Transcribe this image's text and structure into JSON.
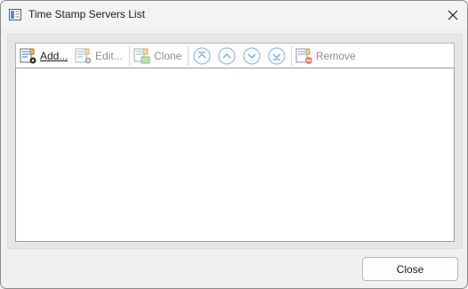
{
  "window": {
    "title": "Time Stamp Servers List"
  },
  "toolbar": {
    "add_label": "Add...",
    "edit_label": "Edit...",
    "clone_label": "Clone",
    "remove_label": "Remove",
    "nav_icons": [
      "move-to-top-icon",
      "move-up-icon",
      "move-down-icon",
      "move-to-bottom-icon"
    ]
  },
  "list": {
    "items": []
  },
  "footer": {
    "close_label": "Close"
  },
  "colors": {
    "accent_blue": "#6aa7e0",
    "disabled_text": "#8d8d8d",
    "remove_red": "#e04a3a",
    "gear_dark": "#2b2b2b"
  }
}
